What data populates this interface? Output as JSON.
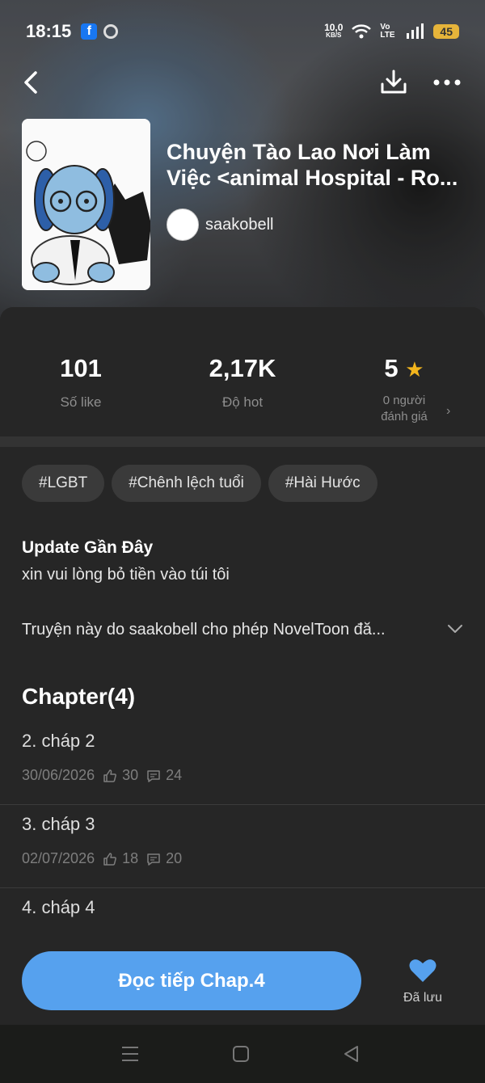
{
  "status_bar": {
    "time": "18:15",
    "speed_value": "10,0",
    "speed_unit": "KB/S",
    "network": "Vo LTE",
    "battery": "45"
  },
  "book": {
    "title_line1": "Chuyện Tào Lao Nơi Làm",
    "title_line2": "Việc <animal Hospital - Ro...",
    "author": "saakobell"
  },
  "stats": [
    {
      "value": "101",
      "label": "Số like"
    },
    {
      "value": "2,17K",
      "label": "Độ hot"
    },
    {
      "value": "5",
      "label_line1": "0 người",
      "label_line2": "đánh giá"
    }
  ],
  "tags": [
    "#LGBT",
    "#Chênh lệch tuổi",
    "#Hài Hước"
  ],
  "update": {
    "title": "Update Gần Đây",
    "text": "xin vui lòng bỏ tiền vào túi tôi"
  },
  "description": "Truyện này do saakobell cho phép NovelToon đă...",
  "chapters_heading": "Chapter(4)",
  "chapters": [
    {
      "name": "2. cháp 2",
      "date": "30/06/2026",
      "likes": "30",
      "comments": "24"
    },
    {
      "name": "3. cháp 3",
      "date": "02/07/2026",
      "likes": "18",
      "comments": "20"
    },
    {
      "name": "4. cháp 4"
    }
  ],
  "bottom": {
    "read_label": "Đọc tiếp Chap.4",
    "saved_label": "Đã lưu"
  },
  "colors": {
    "accent": "#56a1ee",
    "star": "#f2b51d",
    "background": "#262626"
  }
}
